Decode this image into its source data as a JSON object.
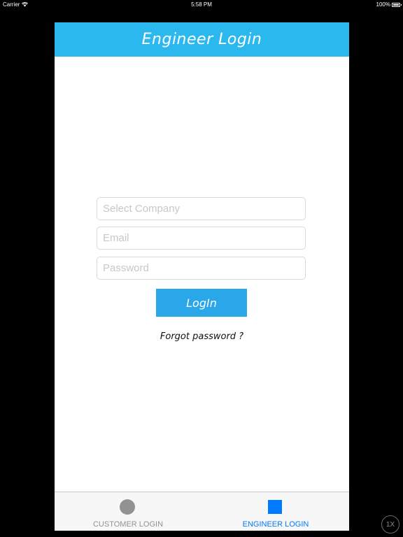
{
  "status_bar": {
    "carrier": "Carrier",
    "time": "5:58 PM",
    "battery": "100%",
    "icons": [
      "wifi-icon",
      "battery-icon"
    ]
  },
  "nav": {
    "title": "Engineer Login",
    "color": "#2bb8ee"
  },
  "form": {
    "company_placeholder": "Select Company",
    "email_placeholder": "Email",
    "password_placeholder": "Password",
    "login_label": "LogIn",
    "forgot_label": "Forgot password ?"
  },
  "tabs": [
    {
      "label": "CUSTOMER LOGIN",
      "icon": "circle-icon",
      "selected": false,
      "color": "#929292"
    },
    {
      "label": "ENGINEER LOGIN",
      "icon": "square-icon",
      "selected": true,
      "color": "#007aff"
    }
  ],
  "zoom": "1X"
}
